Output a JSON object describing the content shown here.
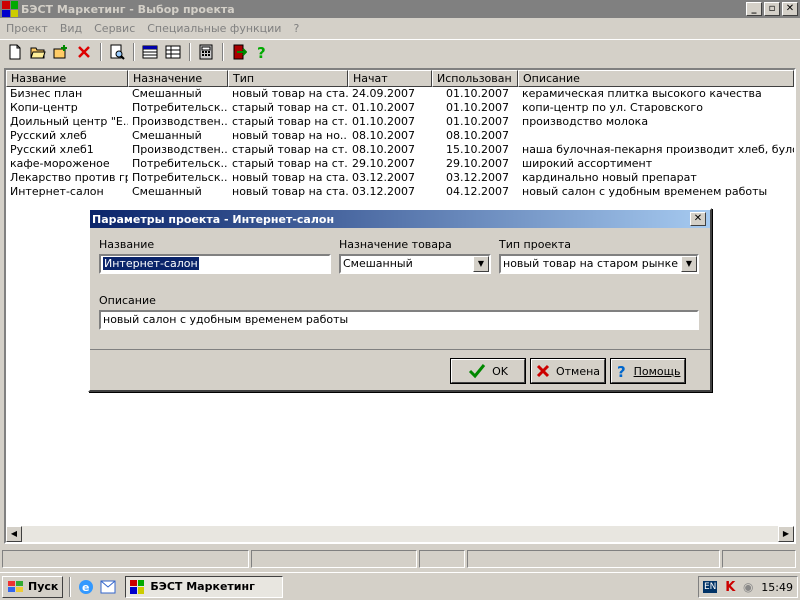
{
  "window": {
    "title": "БЭСТ Маркетинг - Выбор проекта",
    "buttons": [
      "_",
      "▫",
      "✕"
    ]
  },
  "menu": [
    "Проект",
    "Вид",
    "Сервис",
    "Специальные функции",
    "?"
  ],
  "toolbar": {
    "icons": [
      "new-document-icon",
      "open-folder-icon",
      "add-project-icon",
      "delete-icon",
      "search-icon",
      "table-icon",
      "list-icon",
      "calculator-icon",
      "exit-icon",
      "help-icon"
    ]
  },
  "table": {
    "columns": [
      "Название",
      "Назначение",
      "Тип",
      "Начат",
      "Использован",
      "Описание"
    ],
    "rows": [
      [
        "Бизнес план",
        "Смешанный",
        "новый товар на ста...",
        "24.09.2007",
        "01.10.2007",
        "керамическая плитка высокого качества"
      ],
      [
        "Копи-центр",
        "Потребительск...",
        "старый товар на ст...",
        "01.10.2007",
        "01.10.2007",
        "копи-центр по ул. Старовского"
      ],
      [
        "Доильный центр \"Е...",
        "Производствен...",
        "старый товар на ст...",
        "01.10.2007",
        "01.10.2007",
        "производство молока"
      ],
      [
        "Русский хлеб",
        "Смешанный",
        "новый товар на но...",
        "08.10.2007",
        "08.10.2007",
        ""
      ],
      [
        "Русский хлеб1",
        "Производствен...",
        "старый товар на ст...",
        "08.10.2007",
        "15.10.2007",
        "наша булочная-пекарня производит хлеб, булочные из..."
      ],
      [
        "кафе-мороженое",
        "Потребительск...",
        "старый товар на ст...",
        "29.10.2007",
        "29.10.2007",
        "широкий ассортимент"
      ],
      [
        "Лекарство против гри...",
        "Потребительск...",
        "новый товар на ста...",
        "03.12.2007",
        "03.12.2007",
        "кардинально новый препарат"
      ],
      [
        "Интернет-салон",
        "Смешанный",
        "новый товар на ста...",
        "03.12.2007",
        "04.12.2007",
        "новый салон с удобным временем работы"
      ]
    ]
  },
  "dialog": {
    "title": "Параметры проекта - Интернет-салон",
    "name_label": "Название",
    "name_value": "Интернет-салон",
    "purpose_label": "Назначение товара",
    "purpose_value": "Смешанный",
    "type_label": "Тип проекта",
    "type_value": "новый товар на старом рынке",
    "desc_label": "Описание",
    "desc_value": "новый салон с удобным временем работы",
    "ok_label": "OK",
    "cancel_label": "Отмена",
    "help_label": "Помощь"
  },
  "taskbar": {
    "start_label": "Пуск",
    "task_label": "БЭСТ Маркетинг",
    "lang": "EN",
    "clock": "15:49"
  },
  "colors": {
    "title_active_start": "#0a246a",
    "title_active_end": "#a6caf0",
    "title_inactive": "#808080",
    "face": "#d4d0c8"
  }
}
